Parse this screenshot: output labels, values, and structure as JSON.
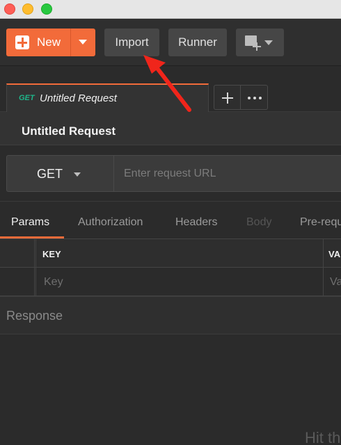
{
  "window": {
    "controls": [
      "close",
      "minimize",
      "zoom"
    ]
  },
  "toolbar": {
    "new_label": "New",
    "import_label": "Import",
    "runner_label": "Runner",
    "new_window_icon": "new-window-icon",
    "accent_color": "#f26b3a"
  },
  "tabs": {
    "active": {
      "method": "GET",
      "title": "Untitled Request"
    },
    "method_color": "#1fb489"
  },
  "request": {
    "title": "Untitled Request",
    "method": "GET",
    "url_placeholder": "Enter request URL"
  },
  "subtabs": [
    {
      "label": "Params",
      "state": "active"
    },
    {
      "label": "Authorization",
      "state": "normal"
    },
    {
      "label": "Headers",
      "state": "normal"
    },
    {
      "label": "Body",
      "state": "disabled"
    },
    {
      "label": "Pre-requ",
      "state": "normal"
    }
  ],
  "params_table": {
    "headers": [
      "KEY",
      "VA"
    ],
    "placeholders": [
      "Key",
      "Va"
    ]
  },
  "response": {
    "label": "Response",
    "hint": "Hit th"
  }
}
